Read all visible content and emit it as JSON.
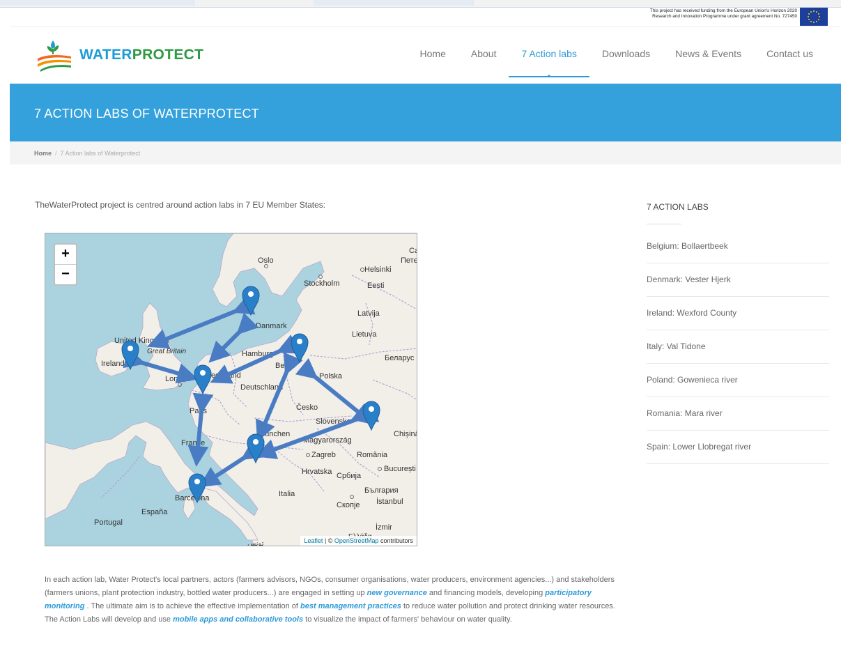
{
  "funding": {
    "line1": "This project has received funding from the European Union's Horizon 2020",
    "line2": "Research and Innovation Programme under grant agreement No. 727450"
  },
  "logo": {
    "part1": "WATER",
    "part2": "PROTECT"
  },
  "nav": {
    "items": [
      {
        "label": "Home"
      },
      {
        "label": "About"
      },
      {
        "label": "7 Action labs",
        "active": true
      },
      {
        "label": "Downloads"
      },
      {
        "label": "News & Events"
      },
      {
        "label": "Contact us"
      }
    ]
  },
  "banner": {
    "title": "7 ACTION LABS OF WATERPROTECT"
  },
  "breadcrumb": {
    "home": "Home",
    "separator": "/",
    "current": "7 Action labs of Waterprotect"
  },
  "intro": "TheWaterProtect project is centred around action labs in 7 EU Member States:",
  "map": {
    "zoom_in": "+",
    "zoom_out": "−",
    "attribution": {
      "leaflet": "Leaflet",
      "sep": " | © ",
      "osm": "OpenStreetMap",
      "suffix": " contributors"
    },
    "labels": {
      "oslo": "Oslo",
      "helsinki": "Helsinki",
      "stockholm": "Stockholm",
      "eesti": "Eesti",
      "latvija": "Latvija",
      "lietuva": "Lietuva",
      "belarus": "Беларус",
      "denmark": "Danmark",
      "uk": "United Kingdom",
      "gb": "Great Britain",
      "ireland": "Ireland",
      "london": "London",
      "hamburg": "Hamburg",
      "berlin": "Berlin",
      "polska": "Polska",
      "nederland": "Nederland",
      "deutschland": "Deutschland",
      "cesko": "Česko",
      "slovensko": "Slovensko",
      "paris": "Paris",
      "munchen": "München",
      "chisinau": "Chișinău",
      "magyar": "Magyarország",
      "france": "France",
      "zagreb": "Zagreb",
      "romania": "România",
      "bucuresti": "București",
      "hrvatska": "Hrvatska",
      "srbija": "Србија",
      "bulgaria": "България",
      "italia": "Italia",
      "barcelona": "Barcelona",
      "skopje": "Скопје",
      "istanbul": "İstanbul",
      "espana": "España",
      "portugal": "Portugal",
      "izmir": "İzmir",
      "ellada": "Ελλάδα",
      "tunis": "تونس",
      "ca": "Ca",
      "pete": "Пете"
    }
  },
  "body": {
    "t1": "In each action lab, Water Protect's local partners, actors (farmers advisors, NGOs, consumer organisations, water producers, environment agencies...) and stakeholders (farmers unions, plant protection industry, bottled water producers...) are engaged in setting up ",
    "h1": "new governance",
    "t2": " and financing models, developing ",
    "h2": "participatory monitoring",
    "t3": " . The ultimate aim is to achieve the effective implementation of ",
    "h3": "best management practices",
    "t4": " to reduce water pollution and protect drinking water resources. The Action Labs will develop and use ",
    "h4": "mobile apps and collaborative tools",
    "t5": " to visualize the impact of farmers' behaviour on water quality."
  },
  "sidebar": {
    "title": "7 ACTION LABS",
    "items": [
      {
        "label": "Belgium: Bollaertbeek"
      },
      {
        "label": "Denmark: Vester Hjerk"
      },
      {
        "label": "Ireland: Wexford County"
      },
      {
        "label": "Italy: Val Tidone"
      },
      {
        "label": "Poland: Gowenieca river"
      },
      {
        "label": "Romania: Mara river"
      },
      {
        "label": "Spain: Lower Llobregat river"
      }
    ]
  },
  "colors": {
    "accent": "#34a1dc",
    "marker": "#2a7fc9",
    "arrow": "#4a7cc4",
    "logo_blue": "#1f9cd7",
    "logo_green": "#2e9a44"
  }
}
